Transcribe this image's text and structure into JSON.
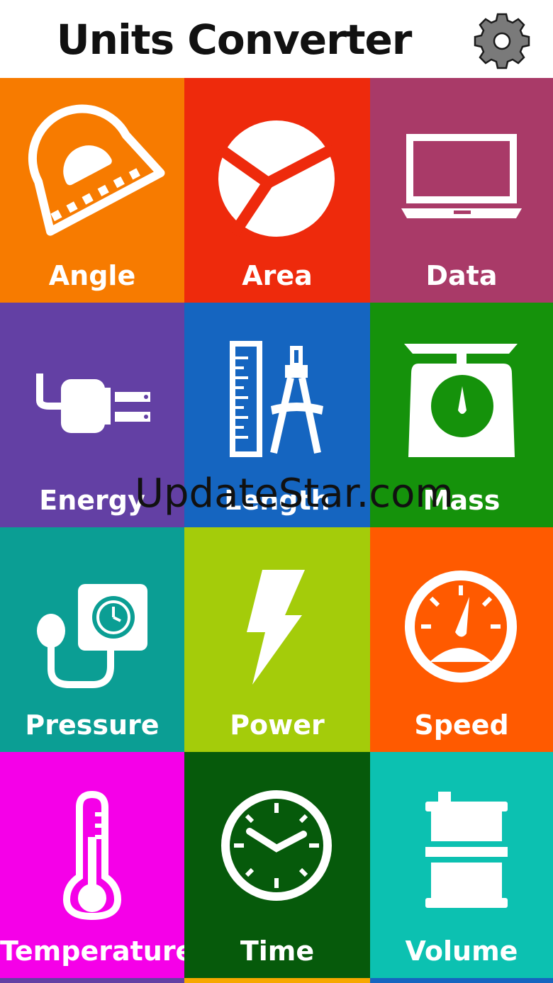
{
  "app": {
    "title": "Units Converter",
    "settings_icon": "gear-icon"
  },
  "colors": {
    "angle": "#F77B00",
    "area": "#EE2A0C",
    "data": "#A93A68",
    "energy": "#6340A4",
    "length": "#1565C0",
    "mass": "#15920B",
    "pressure": "#0B9E94",
    "power": "#A4CC0A",
    "speed": "#FF5A00",
    "temperature": "#F500E8",
    "time": "#065A0B",
    "volume": "#0CC1B1"
  },
  "tiles": [
    {
      "label": "Angle",
      "icon": "protractor-icon"
    },
    {
      "label": "Area",
      "icon": "pie-area-icon"
    },
    {
      "label": "Data",
      "icon": "laptop-icon"
    },
    {
      "label": "Energy",
      "icon": "plug-icon"
    },
    {
      "label": "Length",
      "icon": "ruler-compass-icon"
    },
    {
      "label": "Mass",
      "icon": "scale-icon"
    },
    {
      "label": "Pressure",
      "icon": "pressure-gauge-icon"
    },
    {
      "label": "Power",
      "icon": "lightning-icon"
    },
    {
      "label": "Speed",
      "icon": "speedometer-icon"
    },
    {
      "label": "Temperature",
      "icon": "thermometer-icon"
    },
    {
      "label": "Time",
      "icon": "clock-icon"
    },
    {
      "label": "Volume",
      "icon": "barrel-icon"
    }
  ],
  "watermark": "UpdateStar.com"
}
